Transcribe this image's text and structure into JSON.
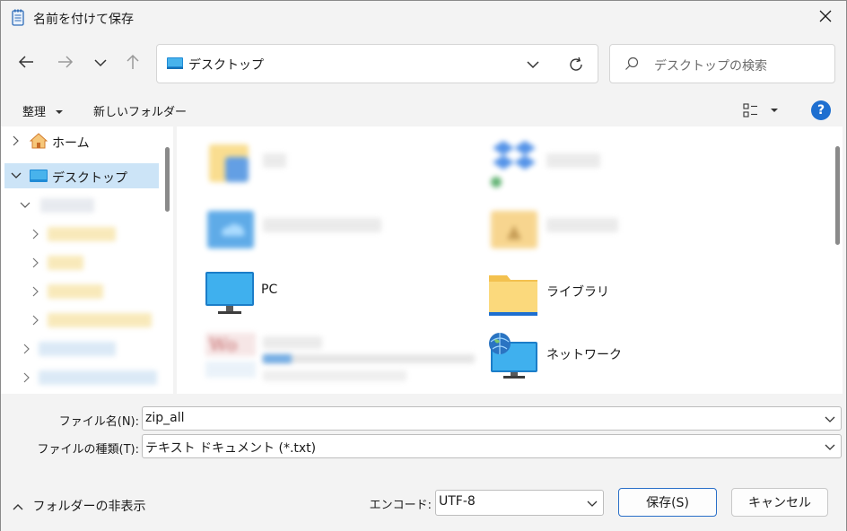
{
  "window": {
    "title": "名前を付けて保存",
    "close_icon": "close-icon"
  },
  "nav": {
    "back_icon": "arrow-left-icon",
    "forward_icon": "arrow-right-icon",
    "recent_icon": "chevron-down-icon",
    "up_icon": "arrow-up-icon",
    "address": "デスクトップ",
    "search_placeholder": "デスクトップの検索"
  },
  "commands": {
    "organize": "整理",
    "new_folder": "新しいフォルダー",
    "help": "?"
  },
  "sidebar": {
    "items": [
      {
        "label": "ホーム",
        "icon": "home-icon"
      },
      {
        "label": "デスクトップ",
        "icon": "desktop-icon",
        "selected": true
      }
    ]
  },
  "content": {
    "items": [
      {
        "label": "PC",
        "icon": "monitor-icon"
      },
      {
        "label": "ライブラリ",
        "icon": "folder-icon"
      },
      {
        "label": "ネットワーク",
        "icon": "network-icon"
      }
    ]
  },
  "form": {
    "filename_label": "ファイル名(N):",
    "filename_value": "zip_all",
    "filetype_label": "ファイルの種類(T):",
    "filetype_value": "テキスト ドキュメント (*.txt)",
    "encoding_label": "エンコード:",
    "encoding_value": "UTF-8"
  },
  "footer": {
    "hide_folders": "フォルダーの非表示",
    "save": "保存(S)",
    "cancel": "キャンセル"
  },
  "colors": {
    "accent": "#1e6fd0",
    "selection": "#cce4f7"
  }
}
